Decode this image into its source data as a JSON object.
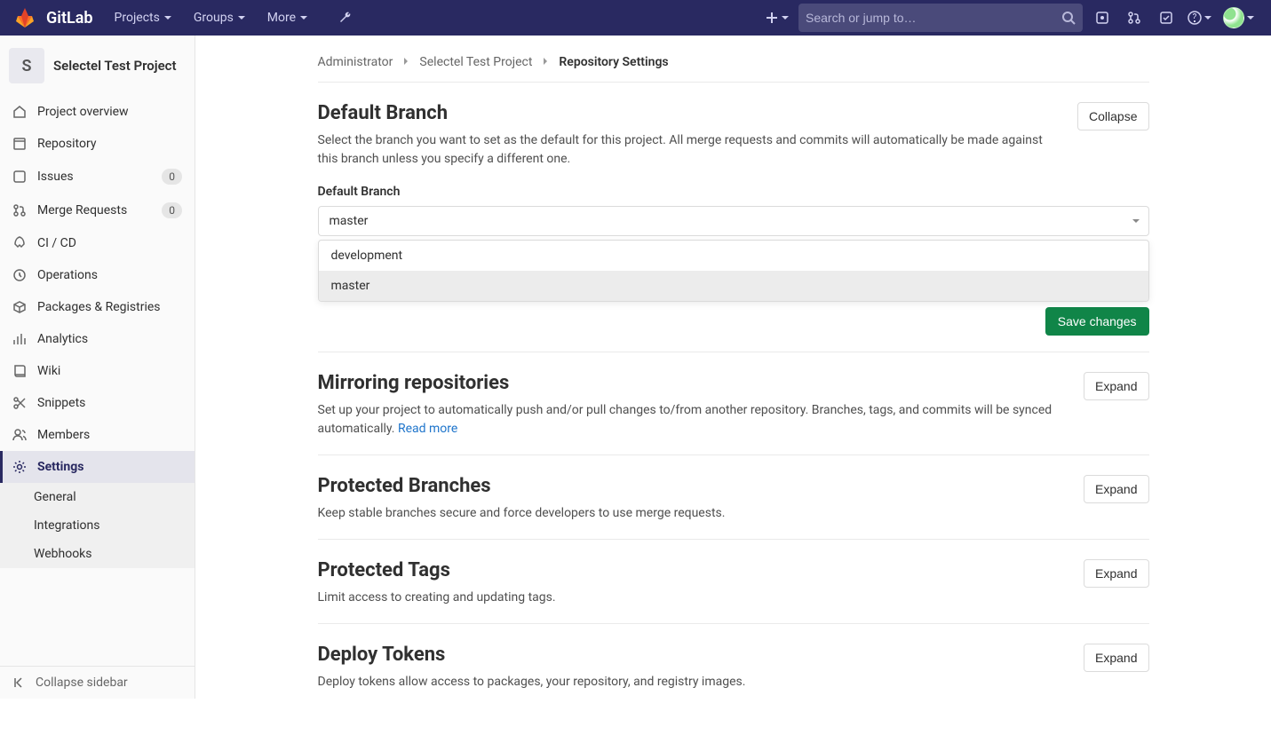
{
  "navbar": {
    "brand": "GitLab",
    "items": [
      "Projects",
      "Groups",
      "More"
    ],
    "search_placeholder": "Search or jump to…"
  },
  "project": {
    "avatar_letter": "S",
    "name": "Selectel Test Project"
  },
  "sidebar": {
    "items": [
      {
        "label": "Project overview"
      },
      {
        "label": "Repository"
      },
      {
        "label": "Issues",
        "badge": "0"
      },
      {
        "label": "Merge Requests",
        "badge": "0"
      },
      {
        "label": "CI / CD"
      },
      {
        "label": "Operations"
      },
      {
        "label": "Packages & Registries"
      },
      {
        "label": "Analytics"
      },
      {
        "label": "Wiki"
      },
      {
        "label": "Snippets"
      },
      {
        "label": "Members"
      },
      {
        "label": "Settings"
      }
    ],
    "settings_sub": [
      "General",
      "Integrations",
      "Webhooks"
    ],
    "collapse_label": "Collapse sidebar"
  },
  "breadcrumb": {
    "a": "Administrator",
    "b": "Selectel Test Project",
    "c": "Repository Settings"
  },
  "sections": {
    "default_branch": {
      "title": "Default Branch",
      "desc": "Select the branch you want to set as the default for this project. All merge requests and commits will automatically be made against this branch unless you specify a different one.",
      "field_label": "Default Branch",
      "selected": "master",
      "options": [
        "development",
        "master"
      ],
      "collapse_btn": "Collapse",
      "save_btn": "Save changes"
    },
    "mirroring": {
      "title": "Mirroring repositories",
      "desc": "Set up your project to automatically push and/or pull changes to/from another repository. Branches, tags, and commits will be synced automatically. ",
      "read_more": "Read more",
      "btn": "Expand"
    },
    "protected_branches": {
      "title": "Protected Branches",
      "desc": "Keep stable branches secure and force developers to use merge requests.",
      "btn": "Expand"
    },
    "protected_tags": {
      "title": "Protected Tags",
      "desc": "Limit access to creating and updating tags.",
      "btn": "Expand"
    },
    "deploy_tokens": {
      "title": "Deploy Tokens",
      "desc": "Deploy tokens allow access to packages, your repository, and registry images.",
      "btn": "Expand"
    }
  }
}
